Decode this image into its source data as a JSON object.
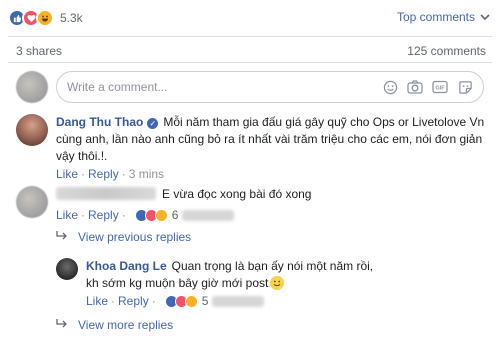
{
  "reactions": {
    "count": "5.3k",
    "types": [
      "like",
      "love",
      "haha"
    ]
  },
  "sort": {
    "label": "Top comments"
  },
  "stats": {
    "shares": "3 shares",
    "comments": "125 comments"
  },
  "composer": {
    "placeholder": "Write a comment...",
    "icons": [
      "emoji-icon",
      "camera-icon",
      "gif-icon",
      "sticker-icon"
    ]
  },
  "comments": [
    {
      "author": "Dang Thu Thao",
      "verified": true,
      "text": "Mỗi năm tham gia đấu giá gây quỹ cho Ops or Livetolove Vn cùng anh, lần nào anh cũng bỏ ra ít nhất vài trăm triệu cho các em, nói đơn giản vậy thôi.!.",
      "like": "Like",
      "reply": "Reply",
      "time": "3 mins"
    },
    {
      "author": "",
      "text": "E vừa đọc xong bài đó xong",
      "like": "Like",
      "reply": "Reply",
      "reaction_count": "6"
    }
  ],
  "view_previous": "View previous replies",
  "reply": {
    "author": "Khoa Dang Le",
    "text": "Quan trọng là bạn ấy nói một năm rồi, kh sớm kg muộn bây giờ mới post",
    "like": "Like",
    "reply": "Reply",
    "reaction_count": "5"
  },
  "view_more": "View more replies"
}
